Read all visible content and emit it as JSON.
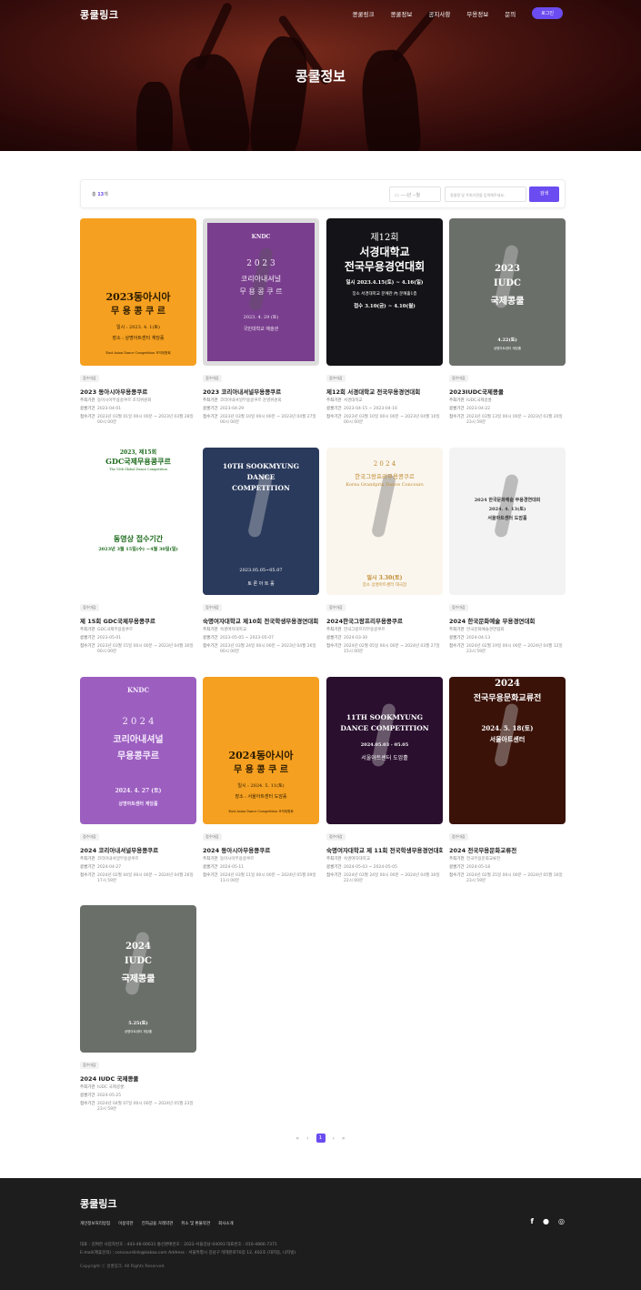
{
  "header": {
    "logo": "콩쿨링크",
    "menu": [
      "콩쿨링크",
      "콩쿨정보",
      "공지사항",
      "무용정보",
      "문의"
    ],
    "login": "로그인",
    "page_title": "콩쿨정보"
  },
  "filter": {
    "total_prefix": "총",
    "total_count": "13",
    "total_suffix": "개",
    "date_placeholder": "----년 --월",
    "keyword_placeholder": "콩쿨명 및 주최기관을 입력해주세요.",
    "search_label": "검색"
  },
  "labels": {
    "host": "주최기관",
    "contest_period": "콩쿨기간",
    "reception_period": "접수기간"
  },
  "cards": [
    {
      "badge": "접수마감",
      "title": "2023 동아시아무용콩쿠르",
      "host": "동아시아무용콩쿠르 조직위원회",
      "contest": "2023-04-01",
      "reception": "2023년 03월 01일 00시 00분 ~ 2023년 03월 28일 00시 00분",
      "poster": {
        "lines": [
          "2023동아시아",
          "무 용 콩 쿠 르",
          "일시 : 2023. 4. 1(토)",
          "장소 : 상명아트센터 계당홀",
          "East Asian Dance Competition 조직위원회"
        ],
        "bg": "#f5a020"
      }
    },
    {
      "badge": "접수마감",
      "title": "2023 코리아내셔널무용콩쿠르",
      "host": "코리아내셔널무용콩쿠르 운영위원회",
      "contest": "2023-04-29",
      "reception": "2023년 03월 10일 00시 00분 ~ 2023년 04월 27일 00시 00분",
      "poster": {
        "lines": [
          "KNDC",
          "2 0 2 3",
          "코리아내셔널",
          "무 용 콩 쿠 르",
          "2023. 4. 29 (토)",
          "국민대학교 예술관"
        ],
        "bg": "#7a3e8e"
      }
    },
    {
      "badge": "접수마감",
      "title": "제12회 서경대학교 전국무용경연대회",
      "host": "서경대학교",
      "contest": "2023-04-15 ~ 2023-04-16",
      "reception": "2023년 03월 10일 00시 00분 ~ 2023년 04월 10일 00시 00분",
      "poster": {
        "lines": [
          "제12회",
          "서경대학교",
          "전국무용경연대회",
          "일시 2023.4.15(토) ~ 4.16(일)",
          "장소 서경대학교 문예관 內 문예홀1층",
          "접수 3.10(금) ~ 4.10(월)"
        ],
        "bg": "#141418"
      }
    },
    {
      "badge": "접수마감",
      "title": "2023IUDC국제콩쿨",
      "host": "IUDC국제콩쿨",
      "contest": "2023-04-22",
      "reception": "2023년 03월 13일 00시 00분 ~ 2023년 03월 20일 23시 59분",
      "poster": {
        "lines": [
          "2023",
          "IUDC",
          "국제콩쿨",
          "4.22(토)",
          "상명아트센터 계당홀"
        ],
        "bg": "#6b6f6a"
      }
    },
    {
      "badge": "접수마감",
      "title": "제 15회 GDC국제무용콩쿠르",
      "host": "GDC국제무용콩쿠르",
      "contest": "2023-05-01",
      "reception": "2023년 03월 15일 00시 00분 ~ 2023년 04월 30일 00시 00분",
      "poster": {
        "lines": [
          "2023, 제15회",
          "GDC국제무용콩쿠르",
          "The 15th Global Dance Competition",
          "동영상 접수기간",
          "2023년 3월 15일(수) ~4월 30일(일)"
        ],
        "bg": "#ffffff"
      }
    },
    {
      "badge": "접수마감",
      "title": "숙명여자대학교 제10회 전국학생무용경연대회",
      "host": "숙명여자대학교",
      "contest": "2023-05-05 ~ 2023-05-07",
      "reception": "2023년 03월 24일 00시 00분 ~ 2023년 04월 26일 00시 00분",
      "poster": {
        "lines": [
          "10TH SOOKMYUNG",
          "DANCE",
          "COMPETITION",
          "2023.05.05~05.07",
          "토 론 아 트 홀"
        ],
        "bg": "#2a3a5c"
      }
    },
    {
      "badge": "접수마감",
      "title": "2024한국그랑프리무용콩쿠르",
      "host": "한국그랑프리무용콩쿠르",
      "contest": "2024-03-30",
      "reception": "2024년 02월 05일 00시 00분 ~ 2024년 03월 27일 15시 00분",
      "poster": {
        "lines": [
          "2 0 2 4",
          "한국그랑프리무용콩쿠르",
          "Korea Grandprix Dance Concours",
          "일시 3.30(토)",
          "장소 상명아트센터 대극장"
        ],
        "bg": "#faf6ee"
      }
    },
    {
      "badge": "접수마감",
      "title": "2024 한국문화예술 무용경연대회",
      "host": "한국문화예술경연협회",
      "contest": "2024-04-13",
      "reception": "2024년 02월 19일 00시 00분 ~ 2024년 04월 12일 23시 59분",
      "poster": {
        "lines": [
          "2024 한국문화예술 무용경연대회",
          "2024. 4. 13(토)",
          "서울아트센터 도암홀"
        ],
        "bg": "#f3f3f3"
      }
    },
    {
      "badge": "접수마감",
      "title": "2024 코리아내셔널무용콩쿠르",
      "host": "코리아내셔널무용콩쿠르",
      "contest": "2024-04-27",
      "reception": "2024년 02월 04일 00시 00분 ~ 2024년 04월 26일 17시 59분",
      "poster": {
        "lines": [
          "KNDC",
          "2 0 2 4",
          "코리아내셔널",
          "무용콩쿠르",
          "2024. 4. 27 (토)",
          "상명아트센터 계당홀"
        ],
        "bg": "#9c5fc0"
      }
    },
    {
      "badge": "접수마감",
      "title": "2024 동아시아무용콩쿠르",
      "host": "동아시아무용콩쿠르",
      "contest": "2024-05-11",
      "reception": "2024년 03월 11일 00시 00분 ~ 2024년 05월 09일 11시 00분",
      "poster": {
        "lines": [
          "2024동아시아",
          "무 용 콩 쿠 르",
          "일시 : 2024. 5. 11(토)",
          "장소 : 서울아트센터 도암홀",
          "East Asian Dance Competition 조직위원회"
        ],
        "bg": "#f5a020"
      }
    },
    {
      "badge": "접수마감",
      "title": "숙명여자대학교 제 11회 전국학생무용경연대회",
      "host": "숙명여자대학교",
      "contest": "2024-05-03 ~ 2024-05-05",
      "reception": "2024년 03월 24일 00시 00분 ~ 2024년 04월 30일 22시 00분",
      "poster": {
        "lines": [
          "11TH SOOKMYUNG",
          "DANCE COMPETITION",
          "2024.05.03 - 05.05",
          "서울아트센터 도암홀"
        ],
        "bg": "#2a0f2f"
      }
    },
    {
      "badge": "접수마감",
      "title": "2024 전국무용문화교류전",
      "host": "전국무용문화교류전",
      "contest": "2024-05-18",
      "reception": "2024년 02월 25일 00시 00분 ~ 2024년 05월 16일 23시 59분",
      "poster": {
        "lines": [
          "2024",
          "전국무용문화교류전",
          "2024. 5. 18(토)",
          "서울아트센터"
        ],
        "bg": "#3a1208"
      }
    },
    {
      "badge": "접수마감",
      "title": "2024 IUDC 국제콩쿨",
      "host": "IUDC 국제콩쿨",
      "contest": "2024-05-25",
      "reception": "2024년 04월 07일 00시 00분 ~ 2024년 05월 23일 23시 59분",
      "poster": {
        "lines": [
          "2024",
          "IUDC",
          "국제콩쿨",
          "5.25(토)",
          "상명아트센터 계당홀"
        ],
        "bg": "#6b6f6a"
      }
    }
  ],
  "pager": {
    "first": "«",
    "prev": "‹",
    "current": "1",
    "next": "›",
    "last": "»"
  },
  "footer": {
    "logo": "콩쿨링크",
    "links": [
      "개인정보처리방침",
      "이용약관",
      "전자금융 거래약관",
      "취소 및 환불약관",
      "회사소개"
    ],
    "info1": "대표 : 김여한     사업자번호 : 443-46-00631     통신판매번호 : 2022-서울강남-04093     대표번호 : 010-4866-7371",
    "info2": "E-mail(제휴문의) : concourslink@kakao.com     Address : 서울특별시 강남구 테헤란로70길 12, 402호 (대치동, 너지빌)",
    "copyright": "Copyright ⓒ 콩쿨링크. All Rights Reserved."
  }
}
